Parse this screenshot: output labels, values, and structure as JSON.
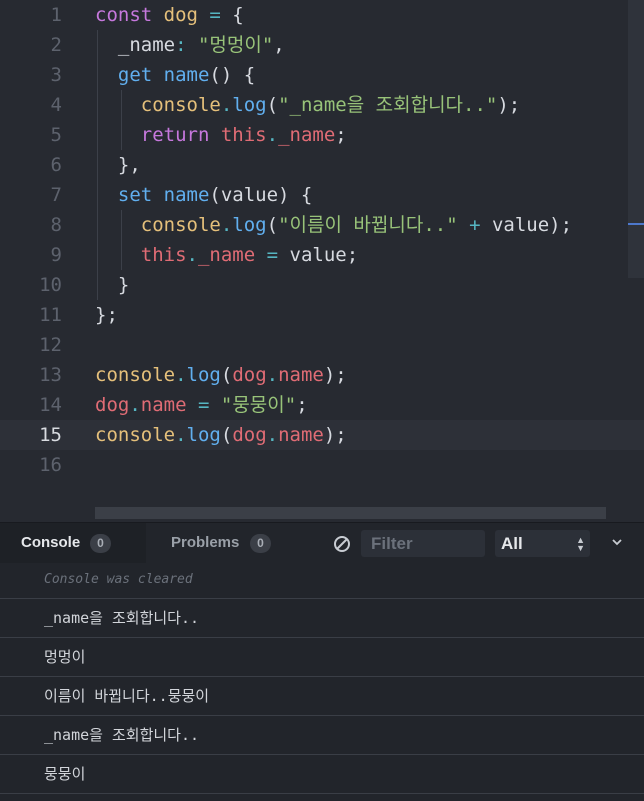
{
  "editor": {
    "current_line": 15,
    "lines": [
      {
        "n": "1",
        "t": [
          [
            "kw",
            "const "
          ],
          [
            "var",
            "dog"
          ],
          [
            "op",
            " = "
          ],
          [
            "pl",
            "{"
          ]
        ]
      },
      {
        "n": "2",
        "t": [
          [
            "pl",
            "  _name"
          ],
          [
            "op",
            ": "
          ],
          [
            "str",
            "\"멍멍이\""
          ],
          [
            "pl",
            ","
          ]
        ]
      },
      {
        "n": "3",
        "t": [
          [
            "pl",
            "  "
          ],
          [
            "fn",
            "get "
          ],
          [
            "fn",
            "name"
          ],
          [
            "pl",
            "() {"
          ]
        ]
      },
      {
        "n": "4",
        "t": [
          [
            "pl",
            "    "
          ],
          [
            "var",
            "console"
          ],
          [
            "op",
            "."
          ],
          [
            "fn",
            "log"
          ],
          [
            "pl",
            "("
          ],
          [
            "str",
            "\"_name을 조회합니다..\""
          ],
          [
            "pl",
            ");"
          ]
        ]
      },
      {
        "n": "5",
        "t": [
          [
            "pl",
            "    "
          ],
          [
            "kw",
            "return "
          ],
          [
            "prop",
            "this"
          ],
          [
            "op",
            "."
          ],
          [
            "prop",
            "_name"
          ],
          [
            "pl",
            ";"
          ]
        ]
      },
      {
        "n": "6",
        "t": [
          [
            "pl",
            "  },"
          ]
        ]
      },
      {
        "n": "7",
        "t": [
          [
            "pl",
            "  "
          ],
          [
            "fn",
            "set "
          ],
          [
            "fn",
            "name"
          ],
          [
            "pl",
            "(value) {"
          ]
        ]
      },
      {
        "n": "8",
        "t": [
          [
            "pl",
            "    "
          ],
          [
            "var",
            "console"
          ],
          [
            "op",
            "."
          ],
          [
            "fn",
            "log"
          ],
          [
            "pl",
            "("
          ],
          [
            "str",
            "\"이름이 바뀝니다..\""
          ],
          [
            "op",
            " + "
          ],
          [
            "pl",
            "value);"
          ]
        ]
      },
      {
        "n": "9",
        "t": [
          [
            "pl",
            "    "
          ],
          [
            "prop",
            "this"
          ],
          [
            "op",
            "."
          ],
          [
            "prop",
            "_name"
          ],
          [
            "op",
            " = "
          ],
          [
            "pl",
            "value;"
          ]
        ]
      },
      {
        "n": "10",
        "t": [
          [
            "pl",
            "  }"
          ]
        ]
      },
      {
        "n": "11",
        "t": [
          [
            "pl",
            "};"
          ]
        ]
      },
      {
        "n": "12",
        "t": []
      },
      {
        "n": "13",
        "t": [
          [
            "var",
            "console"
          ],
          [
            "op",
            "."
          ],
          [
            "fn",
            "log"
          ],
          [
            "pl",
            "("
          ],
          [
            "prop",
            "dog"
          ],
          [
            "op",
            "."
          ],
          [
            "prop",
            "name"
          ],
          [
            "pl",
            ");"
          ]
        ]
      },
      {
        "n": "14",
        "t": [
          [
            "prop",
            "dog"
          ],
          [
            "op",
            "."
          ],
          [
            "prop",
            "name"
          ],
          [
            "op",
            " = "
          ],
          [
            "str",
            "\"뭉뭉이\""
          ],
          [
            "pl",
            ";"
          ]
        ]
      },
      {
        "n": "15",
        "t": [
          [
            "var",
            "console"
          ],
          [
            "op",
            "."
          ],
          [
            "fn",
            "log"
          ],
          [
            "pl",
            "("
          ],
          [
            "prop",
            "dog"
          ],
          [
            "op",
            "."
          ],
          [
            "prop",
            "name"
          ],
          [
            "pl",
            ");"
          ]
        ]
      },
      {
        "n": "16",
        "t": []
      }
    ],
    "colors": {
      "keyword": "#c678dd",
      "function": "#61afef",
      "variable": "#e5c07b",
      "property": "#e06c75",
      "string": "#98c379",
      "operator": "#56b6c2",
      "plain": "#d7dae0"
    }
  },
  "panel": {
    "tabs": {
      "console": {
        "label": "Console",
        "count": "0"
      },
      "problems": {
        "label": "Problems",
        "count": "0"
      }
    },
    "clear_icon": "no-entry-icon",
    "filter": {
      "placeholder": "Filter",
      "value": ""
    },
    "level": {
      "selected": "All"
    },
    "collapse_icon": "chevron-down-icon",
    "logs": [
      {
        "text": "Console was cleared",
        "kind": "cleared"
      },
      {
        "text": "_name을 조회합니다..",
        "kind": "log"
      },
      {
        "text": "멍멍이",
        "kind": "log"
      },
      {
        "text": "이름이 바뀝니다..뭉뭉이",
        "kind": "log"
      },
      {
        "text": "_name을 조회합니다..",
        "kind": "log"
      },
      {
        "text": "뭉뭉이",
        "kind": "log"
      }
    ]
  }
}
